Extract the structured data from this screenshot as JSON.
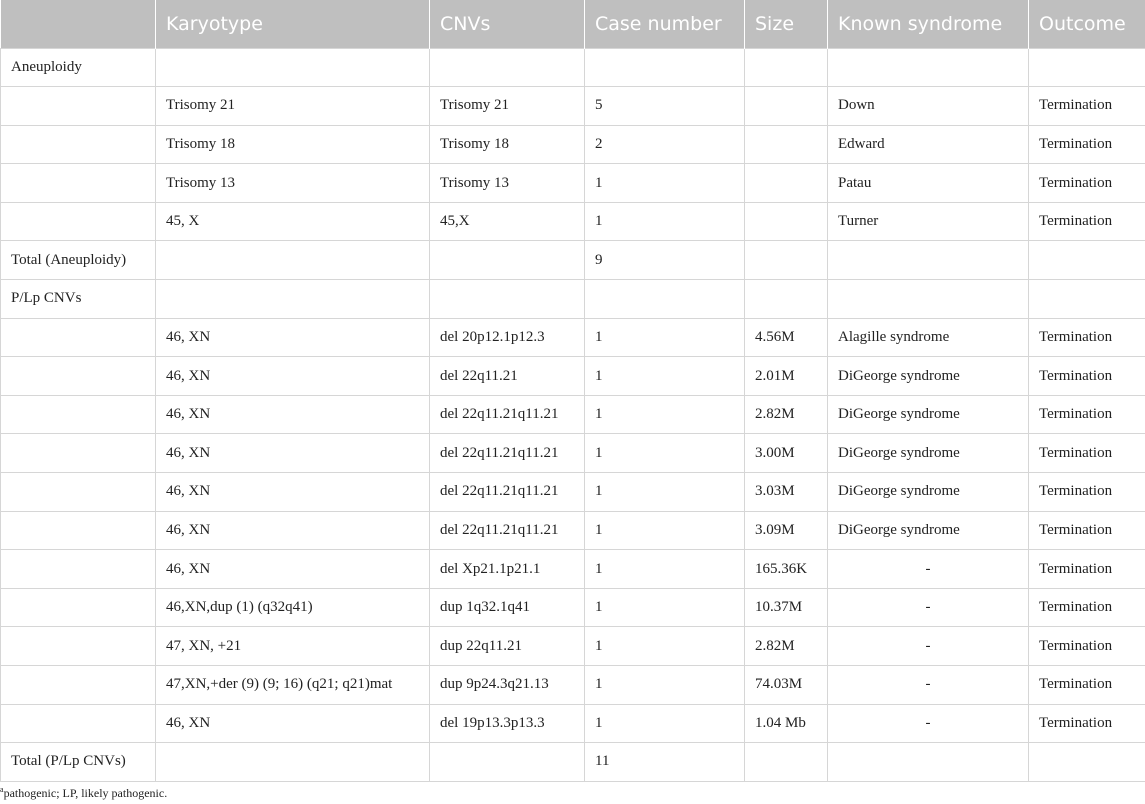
{
  "table": {
    "headers": [
      "",
      "Karyotype",
      "CNVs",
      "Case number",
      "Size",
      "Known syndrome",
      "Outcome"
    ],
    "rows": [
      [
        "Aneuploidy",
        "",
        "",
        "",
        "",
        "",
        ""
      ],
      [
        "",
        "Trisomy 21",
        "Trisomy 21",
        "5",
        "",
        "Down",
        "Termination"
      ],
      [
        "",
        "Trisomy 18",
        "Trisomy 18",
        "2",
        "",
        "Edward",
        "Termination"
      ],
      [
        "",
        "Trisomy 13",
        "Trisomy 13",
        "1",
        "",
        "Patau",
        "Termination"
      ],
      [
        "",
        "45, X",
        "45,X",
        "1",
        "",
        "Turner",
        "Termination"
      ],
      [
        "Total (Aneuploidy)",
        "",
        "",
        "9",
        "",
        "",
        ""
      ],
      [
        "P/Lp CNVs",
        "",
        "",
        "",
        "",
        "",
        ""
      ],
      [
        "",
        "46, XN",
        "del 20p12.1p12.3",
        "1",
        "4.56M",
        "Alagille syndrome",
        "Termination"
      ],
      [
        "",
        "46, XN",
        "del 22q11.21",
        "1",
        "2.01M",
        "DiGeorge syndrome",
        "Termination"
      ],
      [
        "",
        "46, XN",
        "del 22q11.21q11.21",
        "1",
        "2.82M",
        "DiGeorge syndrome",
        "Termination"
      ],
      [
        "",
        "46, XN",
        "del 22q11.21q11.21",
        "1",
        "3.00M",
        "DiGeorge syndrome",
        "Termination"
      ],
      [
        "",
        "46, XN",
        "del 22q11.21q11.21",
        "1",
        "3.03M",
        "DiGeorge syndrome",
        "Termination"
      ],
      [
        "",
        "46, XN",
        "del 22q11.21q11.21",
        "1",
        "3.09M",
        "DiGeorge syndrome",
        "Termination"
      ],
      [
        "",
        "46, XN",
        "del Xp21.1p21.1",
        "1",
        "165.36K",
        "-",
        "Termination"
      ],
      [
        "",
        "46,XN,dup (1) (q32q41)",
        "dup 1q32.1q41",
        "1",
        "10.37M",
        "-",
        "Termination"
      ],
      [
        "",
        "47, XN, +21",
        "dup 22q11.21",
        "1",
        "2.82M",
        "-",
        "Termination"
      ],
      [
        "",
        "47,XN,+der (9) (9; 16) (q21; q21)mat",
        "dup 9p24.3q21.13",
        "1",
        "74.03M",
        "-",
        "Termination"
      ],
      [
        "",
        "46, XN",
        "del 19p13.3p13.3",
        "1",
        "1.04 Mb",
        "-",
        "Termination"
      ],
      [
        "Total (P/Lp CNVs)",
        "",
        "",
        "11",
        "",
        "",
        ""
      ]
    ]
  },
  "footnote": {
    "marker": "a",
    "text": "pathogenic; LP, likely pathogenic."
  }
}
